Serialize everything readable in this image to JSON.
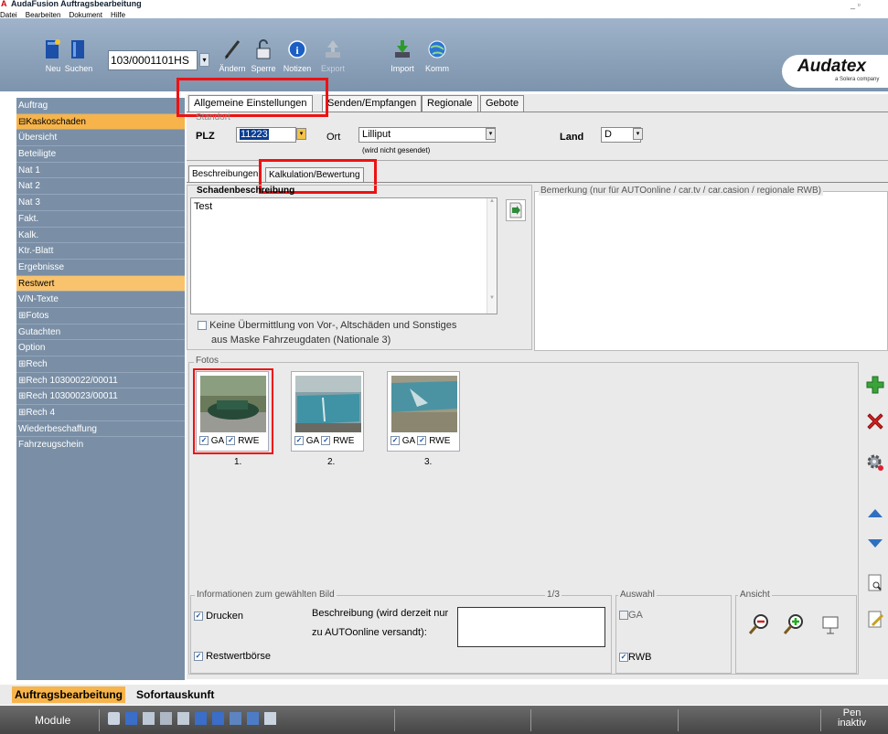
{
  "window": {
    "title": "AudaFusion Auftragsbearbeitung",
    "controls": "_ ▫"
  },
  "menu": [
    "Datei",
    "Bearbeiten",
    "Dokument",
    "Hilfe"
  ],
  "toolbar": {
    "buttons": [
      {
        "label": "Neu",
        "icon": "new-icon",
        "enabled": true
      },
      {
        "label": "Suchen",
        "icon": "search-icon",
        "enabled": true
      },
      {
        "label": "Ändern",
        "icon": "pen-icon",
        "enabled": true
      },
      {
        "label": "Sperre",
        "icon": "lock-icon",
        "enabled": true
      },
      {
        "label": "Notizen",
        "icon": "info-icon",
        "enabled": true
      },
      {
        "label": "Export",
        "icon": "export-icon",
        "enabled": false
      },
      {
        "label": "Import",
        "icon": "import-icon",
        "enabled": true
      },
      {
        "label": "Komm",
        "icon": "globe-icon",
        "enabled": true
      }
    ],
    "order_number": "103/0001101HS",
    "brand": "Audatex",
    "brand_sub": "a Solera company"
  },
  "sidebar": {
    "items": [
      {
        "label": "Auftrag",
        "style": "head"
      },
      {
        "label": "⊟Kaskoschaden",
        "style": "sel"
      },
      {
        "label": "Übersicht"
      },
      {
        "label": "Beteiligte"
      },
      {
        "label": "Nat 1"
      },
      {
        "label": "Nat 2"
      },
      {
        "label": "Nat 3"
      },
      {
        "label": "Fakt."
      },
      {
        "label": "Kalk."
      },
      {
        "label": "Ktr.-Blatt"
      },
      {
        "label": "Ergebnisse"
      },
      {
        "label": "Restwert",
        "style": "sel2"
      },
      {
        "label": "V/N-Texte"
      },
      {
        "label": "⊞Fotos"
      },
      {
        "label": "Gutachten"
      },
      {
        "label": "Option"
      },
      {
        "label": "⊞Rech"
      },
      {
        "label": "⊞Rech 10300022/00011"
      },
      {
        "label": "⊞Rech 10300023/00011"
      },
      {
        "label": "⊞Rech 4"
      },
      {
        "label": "Wiederbeschaffung"
      },
      {
        "label": "Fahrzeugschein"
      }
    ]
  },
  "tabs": [
    "Allgemeine Einstellungen",
    "Senden/Empfangen",
    "Regionale",
    "Gebote"
  ],
  "standort": {
    "group_title": "Standort",
    "plz_label": "PLZ",
    "plz_value": "11223",
    "ort_label": "Ort",
    "ort_value": "Lilliput",
    "ort_note": "(wird nicht gesendet)",
    "land_label": "Land",
    "land_value": "D"
  },
  "subtabs": [
    "Beschreibungen",
    "Kalkulation/Bewertung"
  ],
  "schaden": {
    "title": "Schadenbeschreibung",
    "text": "Test",
    "checkbox_line1": "Keine Übermittlung von Vor-, Altschäden und Sonstiges",
    "checkbox_line2": "aus Maske Fahrzeugdaten (Nationale 3)",
    "checked": false
  },
  "bemerkung": {
    "title": "Bemerkung (nur für AUTOonline / car.tv / car.casion / regionale RWB)"
  },
  "fotos": {
    "title": "Fotos",
    "items": [
      {
        "num": "1.",
        "ga": "GA",
        "rwb": "RWE"
      },
      {
        "num": "2.",
        "ga": "GA",
        "rwb": "RWE"
      },
      {
        "num": "3.",
        "ga": "GA",
        "rwb": "RWE"
      }
    ]
  },
  "info": {
    "title": "Informationen zum gewählten Bild",
    "counter": "1/3",
    "drucken": "Drucken",
    "restwertboerse": "Restwertbörse",
    "beschreibung1": "Beschreibung (wird derzeit nur",
    "beschreibung2": "zu AUTOonline versandt):"
  },
  "auswahl": {
    "title": "Auswahl",
    "ga": "GA",
    "rwb": "RWB"
  },
  "ansicht": {
    "title": "Ansicht"
  },
  "bottomtabs": [
    "Auftragsbearbeitung",
    "Sofortauskunft"
  ],
  "status": {
    "module": "Module",
    "pen1": "Pen",
    "pen2": "inaktiv"
  }
}
